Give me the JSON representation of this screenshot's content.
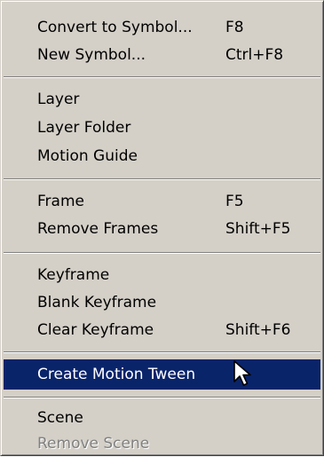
{
  "menu": {
    "items": [
      {
        "label": "Convert to Symbol...",
        "shortcut": "F8"
      },
      {
        "label": "New Symbol...",
        "shortcut": "Ctrl+F8"
      },
      {
        "label": "Layer",
        "shortcut": ""
      },
      {
        "label": "Layer Folder",
        "shortcut": ""
      },
      {
        "label": "Motion Guide",
        "shortcut": ""
      },
      {
        "label": "Frame",
        "shortcut": "F5"
      },
      {
        "label": "Remove Frames",
        "shortcut": "Shift+F5"
      },
      {
        "label": "Keyframe",
        "shortcut": ""
      },
      {
        "label": "Blank Keyframe",
        "shortcut": ""
      },
      {
        "label": "Clear Keyframe",
        "shortcut": "Shift+F6"
      },
      {
        "label": "Create Motion Tween",
        "shortcut": ""
      },
      {
        "label": "Scene",
        "shortcut": ""
      },
      {
        "label": "Remove Scene",
        "shortcut": ""
      }
    ],
    "highlighted_item": "Create Motion Tween",
    "disabled_item": "Remove Scene",
    "colors": {
      "menu_background": "#d4d0c8",
      "highlight_background": "#0a246a",
      "highlight_text": "#ffffff",
      "disabled_text": "#808080"
    }
  },
  "cursor": {
    "icon": "arrow-pointer-icon"
  }
}
